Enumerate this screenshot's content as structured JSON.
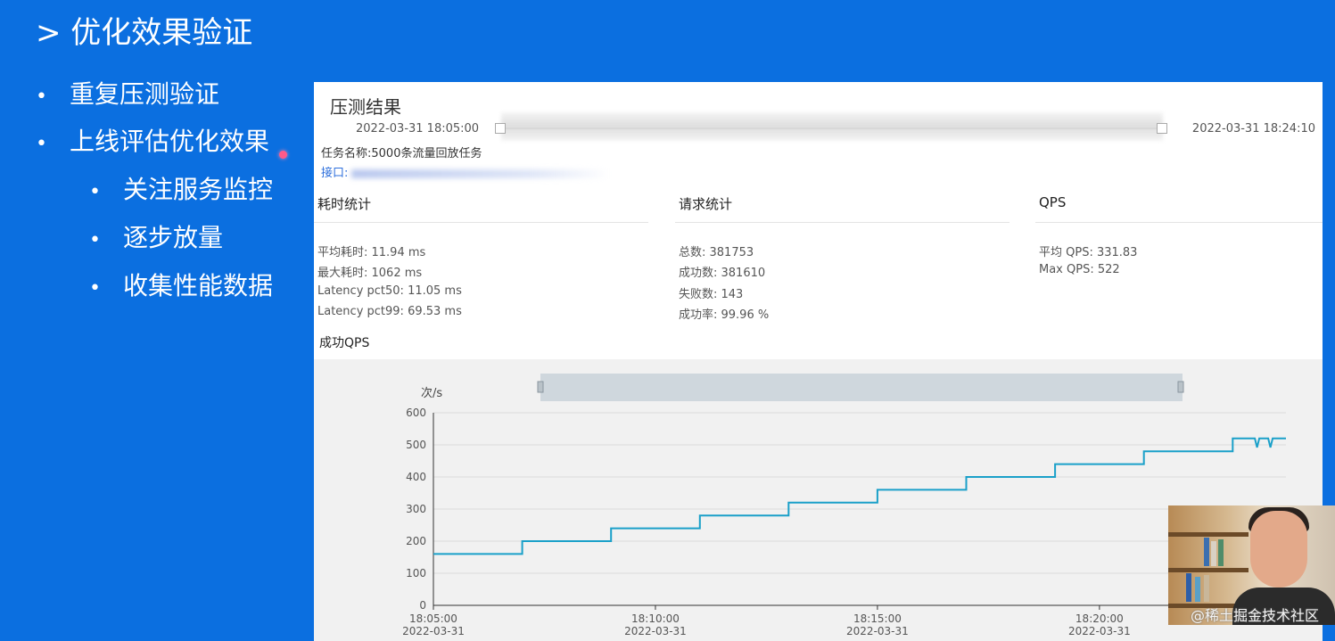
{
  "slide": {
    "title": "> 优化效果验证",
    "bullets": [
      {
        "text": "重复压测验证",
        "level": 1
      },
      {
        "text": "上线评估优化效果",
        "level": 1
      },
      {
        "text": "关注服务监控",
        "level": 2
      },
      {
        "text": "逐步放量",
        "level": 2
      },
      {
        "text": "收集性能数据",
        "level": 2
      }
    ],
    "bullet_glyph": "•"
  },
  "panel": {
    "title": "压测结果",
    "time_start": "2022-03-31 18:05:00",
    "time_end": "2022-03-31 18:24:10",
    "task_name": "任务名称:5000条流量回放任务",
    "api_label": "接口:",
    "sections": {
      "latency": {
        "title": "耗时统计",
        "rows": [
          "平均耗时:  11.94 ms",
          "最大耗时:  1062 ms",
          "Latency pct50:  11.05 ms",
          "Latency pct99:  69.53 ms"
        ]
      },
      "requests": {
        "title": "请求统计",
        "rows": [
          "总数:  381753",
          "成功数:  381610",
          "失败数:  143",
          "成功率:  99.96 %"
        ]
      },
      "qps": {
        "title": "QPS",
        "rows": [
          "平均 QPS:  331.83",
          "Max QPS:  522"
        ]
      }
    },
    "chart_title": "成功QPS"
  },
  "chart_data": {
    "type": "line",
    "ylabel": "次/s",
    "ylim": [
      0,
      600
    ],
    "yticks": [
      0,
      100,
      200,
      300,
      400,
      500,
      600
    ],
    "x_ticks": [
      {
        "time": "18:05:00",
        "date": "2022-03-31"
      },
      {
        "time": "18:10:00",
        "date": "2022-03-31"
      },
      {
        "time": "18:15:00",
        "date": "2022-03-31"
      },
      {
        "time": "18:20:00",
        "date": "2022-03-31"
      }
    ],
    "xlim_minutes": [
      0,
      19.2
    ],
    "series": [
      {
        "color": "#1aa0c9",
        "points_minutes_since_18_05": [
          [
            0,
            160
          ],
          [
            2,
            160
          ],
          [
            2,
            200
          ],
          [
            4,
            200
          ],
          [
            4,
            240
          ],
          [
            6,
            240
          ],
          [
            6,
            280
          ],
          [
            8,
            280
          ],
          [
            8,
            320
          ],
          [
            10,
            320
          ],
          [
            10,
            360
          ],
          [
            12,
            360
          ],
          [
            12,
            400
          ],
          [
            14,
            400
          ],
          [
            14,
            440
          ],
          [
            16,
            440
          ],
          [
            16,
            480
          ],
          [
            18,
            480
          ],
          [
            18,
            520
          ],
          [
            18.5,
            520
          ],
          [
            18.55,
            492
          ],
          [
            18.6,
            520
          ],
          [
            18.8,
            520
          ],
          [
            18.85,
            492
          ],
          [
            18.9,
            520
          ],
          [
            19.2,
            520
          ]
        ]
      }
    ],
    "grid": true,
    "legend": "none"
  },
  "overlay": {
    "watermark": "@稀土掘金技术社区"
  },
  "colors": {
    "slide_bg": "#0b6fe0",
    "line": "#1aa0c9",
    "link": "#2d6fdc"
  }
}
